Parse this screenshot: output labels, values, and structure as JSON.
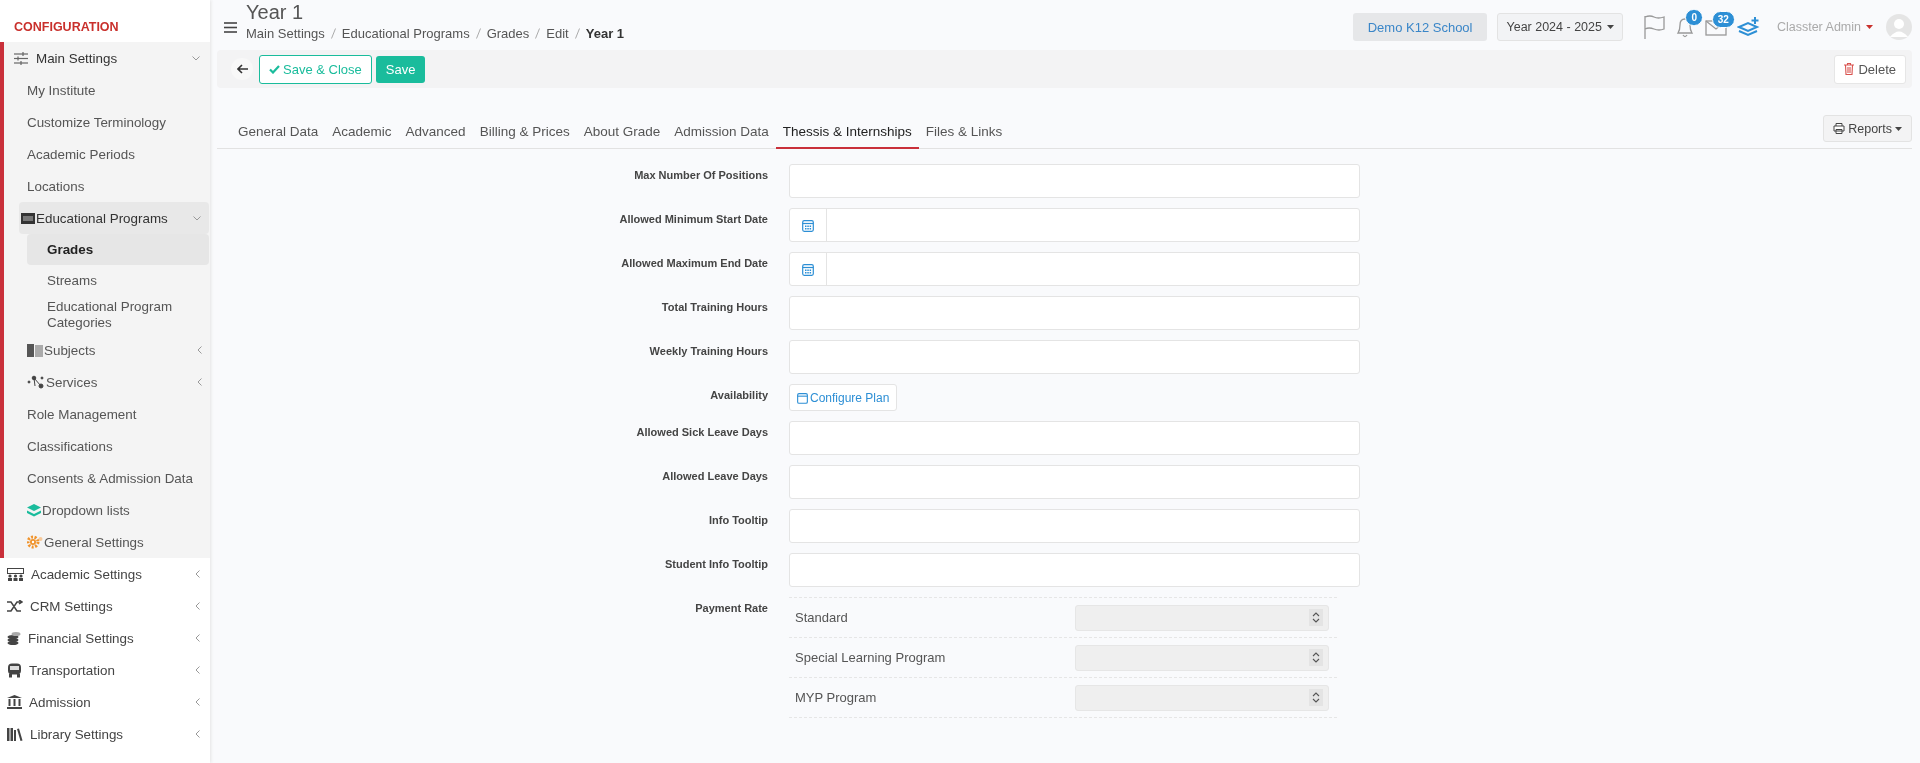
{
  "sidebar": {
    "heading": "CONFIGURATION",
    "items": [
      {
        "label": "Main Settings",
        "expanded": true,
        "selected": false,
        "children": [
          {
            "label": "My Institute",
            "selected": false
          },
          {
            "label": "Customize Terminology",
            "selected": false
          },
          {
            "label": "Academic Periods",
            "selected": false
          },
          {
            "label": "Locations",
            "selected": false
          },
          {
            "label": "Educational Programs",
            "expanded": true,
            "selected": false,
            "children": [
              {
                "label": "Grades",
                "selected": true
              },
              {
                "label": "Streams",
                "selected": false
              },
              {
                "label": "Educational Program Categories",
                "selected": false
              }
            ]
          },
          {
            "label": "Subjects",
            "expanded": false,
            "selected": false
          },
          {
            "label": "Services",
            "expanded": false,
            "selected": false
          },
          {
            "label": "Role Management",
            "selected": false
          },
          {
            "label": "Classifications",
            "selected": false
          },
          {
            "label": "Consents & Admission Data",
            "selected": false
          },
          {
            "label": "Dropdown lists",
            "selected": false
          },
          {
            "label": "General Settings",
            "selected": false
          }
        ]
      },
      {
        "label": "Academic Settings",
        "expanded": false,
        "selected": false
      },
      {
        "label": "CRM Settings",
        "expanded": false,
        "selected": false
      },
      {
        "label": "Financial Settings",
        "expanded": false,
        "selected": false
      },
      {
        "label": "Transportation",
        "expanded": false,
        "selected": false
      },
      {
        "label": "Admission",
        "expanded": false,
        "selected": false
      },
      {
        "label": "Library Settings",
        "expanded": false,
        "selected": false
      }
    ]
  },
  "header": {
    "title": "Year 1",
    "breadcrumb": [
      {
        "label": "Main Settings",
        "current": false
      },
      {
        "label": "Educational Programs",
        "current": false
      },
      {
        "label": "Grades",
        "current": false
      },
      {
        "label": "Edit",
        "current": false
      },
      {
        "label": "Year 1",
        "current": true
      }
    ],
    "school": "Demo K12 School",
    "year": "Year 2024 - 2025",
    "notifications": "0",
    "messages": "32",
    "user": "Classter Admin"
  },
  "toolbar": {
    "save_close": "Save & Close",
    "save": "Save",
    "delete": "Delete"
  },
  "tabs": [
    {
      "label": "General Data",
      "selected": false
    },
    {
      "label": "Academic",
      "selected": false
    },
    {
      "label": "Advanced",
      "selected": false
    },
    {
      "label": "Billing & Prices",
      "selected": false
    },
    {
      "label": "About Grade",
      "selected": false
    },
    {
      "label": "Admission Data",
      "selected": false
    },
    {
      "label": "Thessis & Internships",
      "selected": true
    },
    {
      "label": "Files & Links",
      "selected": false
    }
  ],
  "reports": "Reports",
  "fields": [
    {
      "kind": "text",
      "label": "Max Number Of Positions"
    },
    {
      "kind": "date",
      "label": "Allowed Minimum Start Date"
    },
    {
      "kind": "date",
      "label": "Allowed Maximum End Date"
    },
    {
      "kind": "text",
      "label": "Total Training Hours"
    },
    {
      "kind": "text",
      "label": "Weekly Training Hours"
    },
    {
      "kind": "button",
      "label": "Availability",
      "button": "Configure Plan"
    },
    {
      "kind": "text",
      "label": "Allowed Sick Leave Days"
    },
    {
      "kind": "text",
      "label": "Allowed Leave Days"
    },
    {
      "kind": "text",
      "label": "Info Tooltip"
    },
    {
      "kind": "text",
      "label": "Student Info Tooltip"
    },
    {
      "kind": "rates",
      "label": "Payment Rate",
      "rows": [
        {
          "label": "Standard",
          "disabled": true
        },
        {
          "label": "Special Learning Program",
          "disabled": true
        },
        {
          "label": "MYP Program",
          "disabled": true
        }
      ]
    }
  ]
}
